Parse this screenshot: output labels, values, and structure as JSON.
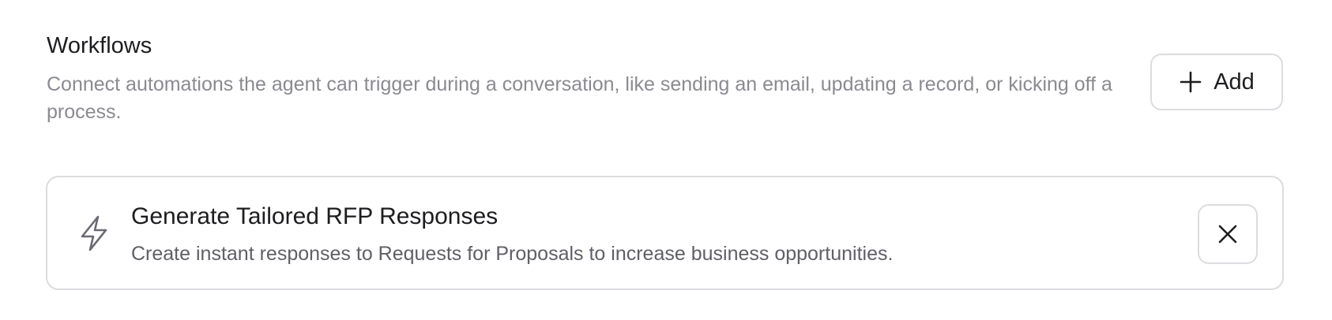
{
  "section": {
    "title": "Workflows",
    "description": "Connect automations the agent can trigger during a conversation, like sending an email, updating a record, or kicking off a process.",
    "add_button_label": "Add"
  },
  "workflows": [
    {
      "icon": "lightning-bolt-icon",
      "title": "Generate Tailored RFP Responses",
      "description": "Create instant responses to Requests for Proposals to increase business opportunities."
    }
  ],
  "icons": {
    "add": "plus-icon",
    "remove": "close-icon"
  },
  "colors": {
    "title": "#1d1d20",
    "description": "#8a8a90",
    "card_description": "#5f5f66",
    "border": "#dcdce0",
    "background": "#ffffff"
  }
}
